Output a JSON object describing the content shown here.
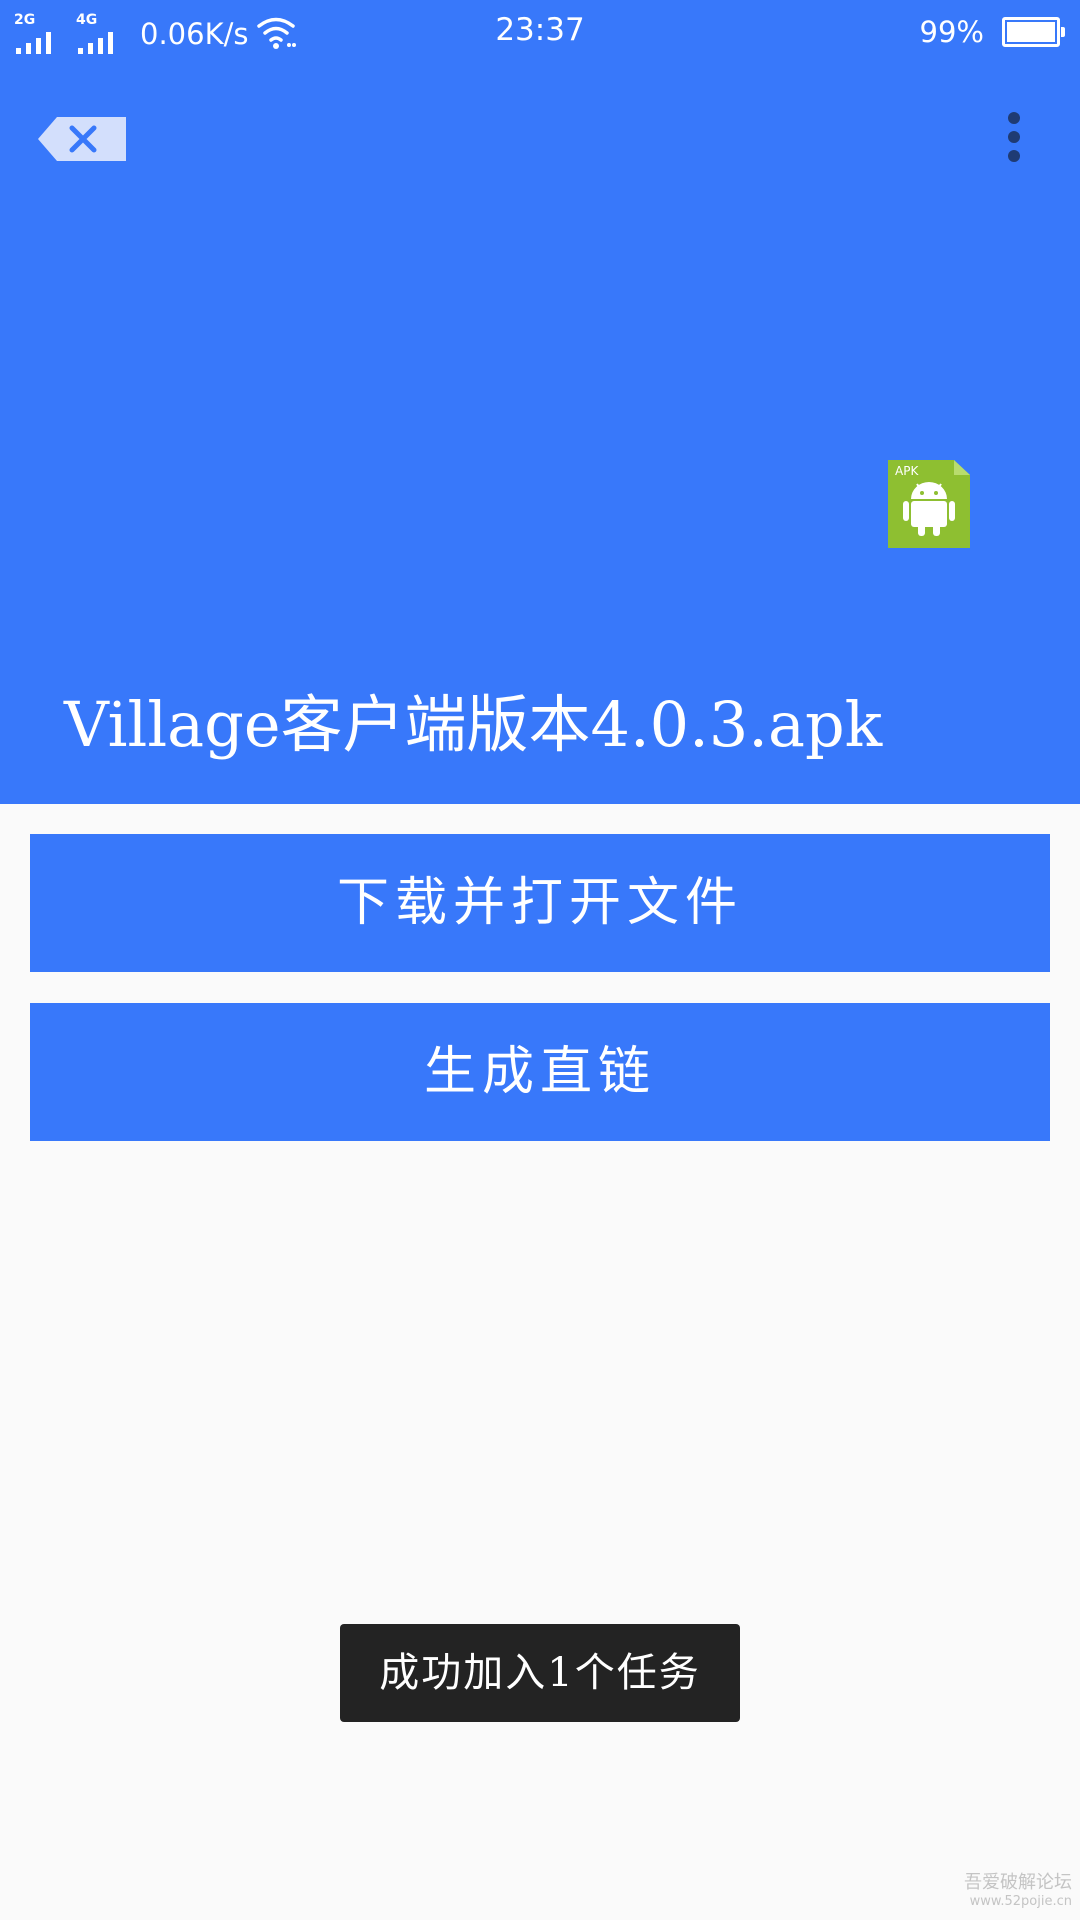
{
  "status_bar": {
    "network_1": "2G",
    "network_2": "4G",
    "speed": "0.06K/s",
    "time": "23:37",
    "battery": "99%",
    "battery_level": 0.99
  },
  "header": {
    "back_icon": "backspace-close-icon",
    "menu_icon": "more-vertical-icon",
    "file_icon": "apk-file-icon",
    "file_icon_label": "APK",
    "file_name": "Village客户端版本4.0.3.apk"
  },
  "actions": {
    "download_open": "下载并打开文件",
    "generate_link": "生成直链"
  },
  "toast": {
    "message": "成功加入1个任务"
  },
  "watermark": {
    "line1": "吾爱破解论坛",
    "line2": "www.52pojie.cn"
  },
  "colors": {
    "accent": "#3878fa",
    "background": "#fafafa",
    "toast": "#232323",
    "apk_green": "#8ebf31"
  }
}
